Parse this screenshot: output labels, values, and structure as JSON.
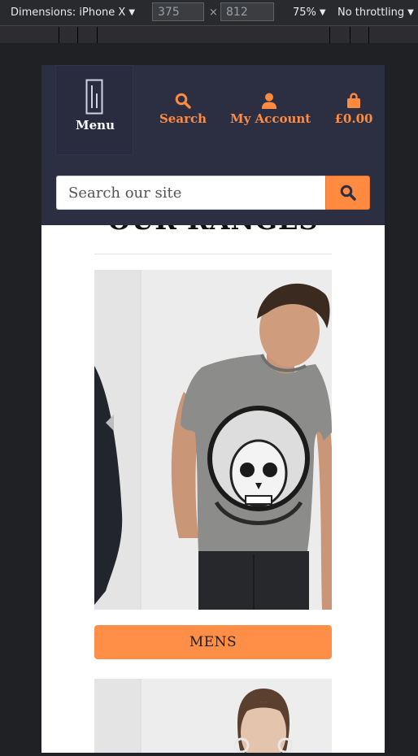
{
  "devtools": {
    "dimensions_label": "Dimensions: iPhone X",
    "width_value": "375",
    "times_sign": "×",
    "height_value": "812",
    "zoom": "75%",
    "throttling": "No throttling"
  },
  "header": {
    "menu_label": "Menu",
    "search_label": "Search",
    "account_label": "My Account",
    "basket_label": "£0.00",
    "search_placeholder": "Search our site",
    "accent_color": "#ff8a40",
    "background_color": "#2c2f42"
  },
  "main": {
    "section_title": "OUR RANGES",
    "categories": [
      {
        "label": "MENS",
        "image_icon": "mens-tshirt-photo"
      }
    ]
  },
  "icons": {
    "menu": "menu-logo-icon",
    "search": "search-icon",
    "account": "user-icon",
    "basket": "shopping-bag-icon",
    "carousel_prev": "chevron-left-icon",
    "carousel_next": "chevron-right-icon"
  }
}
